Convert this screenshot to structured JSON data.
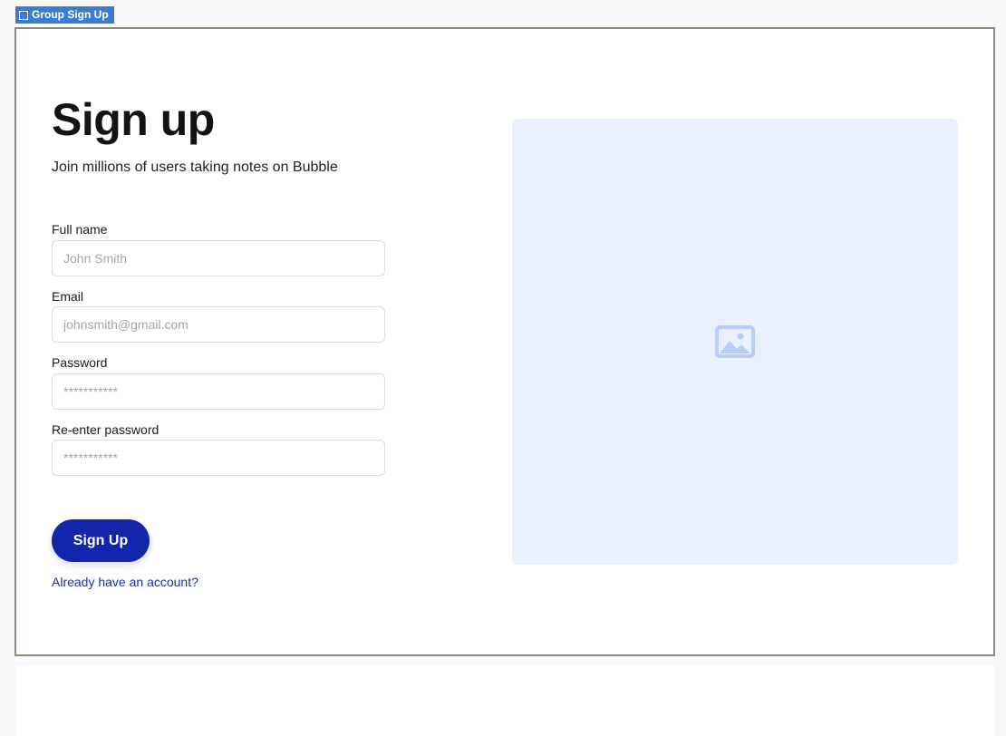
{
  "group_tag": {
    "label": "Group Sign Up",
    "icon": "dashed-selection-icon"
  },
  "form": {
    "title": "Sign up",
    "subtitle": "Join millions of users taking notes on Bubble",
    "fields": [
      {
        "label": "Full name",
        "placeholder": "John Smith",
        "value": ""
      },
      {
        "label": "Email",
        "placeholder": "johnsmith@gmail.com",
        "value": ""
      },
      {
        "label": "Password",
        "placeholder": "***********",
        "value": ""
      },
      {
        "label": "Re-enter password",
        "placeholder": "***********",
        "value": ""
      }
    ],
    "submit_label": "Sign Up",
    "signin_link": "Already have an account?"
  },
  "image_placeholder": {
    "icon": "image-icon"
  },
  "colors": {
    "primary": "#1326ab",
    "link": "#1a2fa8",
    "image_bg": "#eaf0fd",
    "image_icon": "#b9cdf8",
    "tag_bg": "#3b7bd4"
  }
}
